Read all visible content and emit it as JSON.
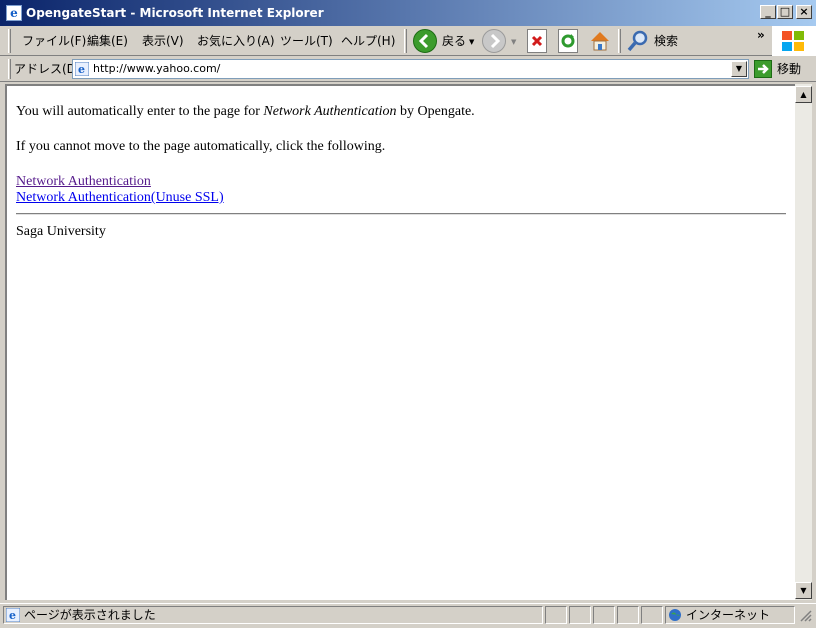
{
  "window": {
    "title": "OpengateStart - Microsoft Internet Explorer",
    "controls": {
      "minimize": "_",
      "maximize": "□",
      "close": "×"
    }
  },
  "menu": [
    {
      "label": "ファイル(F)"
    },
    {
      "label": "編集(E)"
    },
    {
      "label": "表示(V)"
    },
    {
      "label": "お気に入り(A)"
    },
    {
      "label": "ツール(T)"
    },
    {
      "label": "ヘルプ(H)"
    }
  ],
  "toolbar": {
    "back_label": "戻る",
    "search_label": "検索",
    "chevron": "»"
  },
  "address": {
    "label": "アドレス(D)",
    "url": "http://www.yahoo.com/",
    "go_label": "移動"
  },
  "page": {
    "line1_pre": "You will automatically enter to the page for ",
    "line1_em": "Network Authentication",
    "line1_post": " by Opengate.",
    "line2": "If you cannot move to the page automatically, click the following.",
    "link1": "Network Authentication",
    "link2": "Network Authentication(Unuse SSL)",
    "footer": "Saga University"
  },
  "status": {
    "text": "ページが表示されました",
    "zone": "インターネット"
  },
  "colors": {
    "titlebar_start": "#0a246a",
    "titlebar_end": "#a6caf0",
    "link_visited": "#551a8b",
    "link_unvisited": "#0000ee"
  }
}
